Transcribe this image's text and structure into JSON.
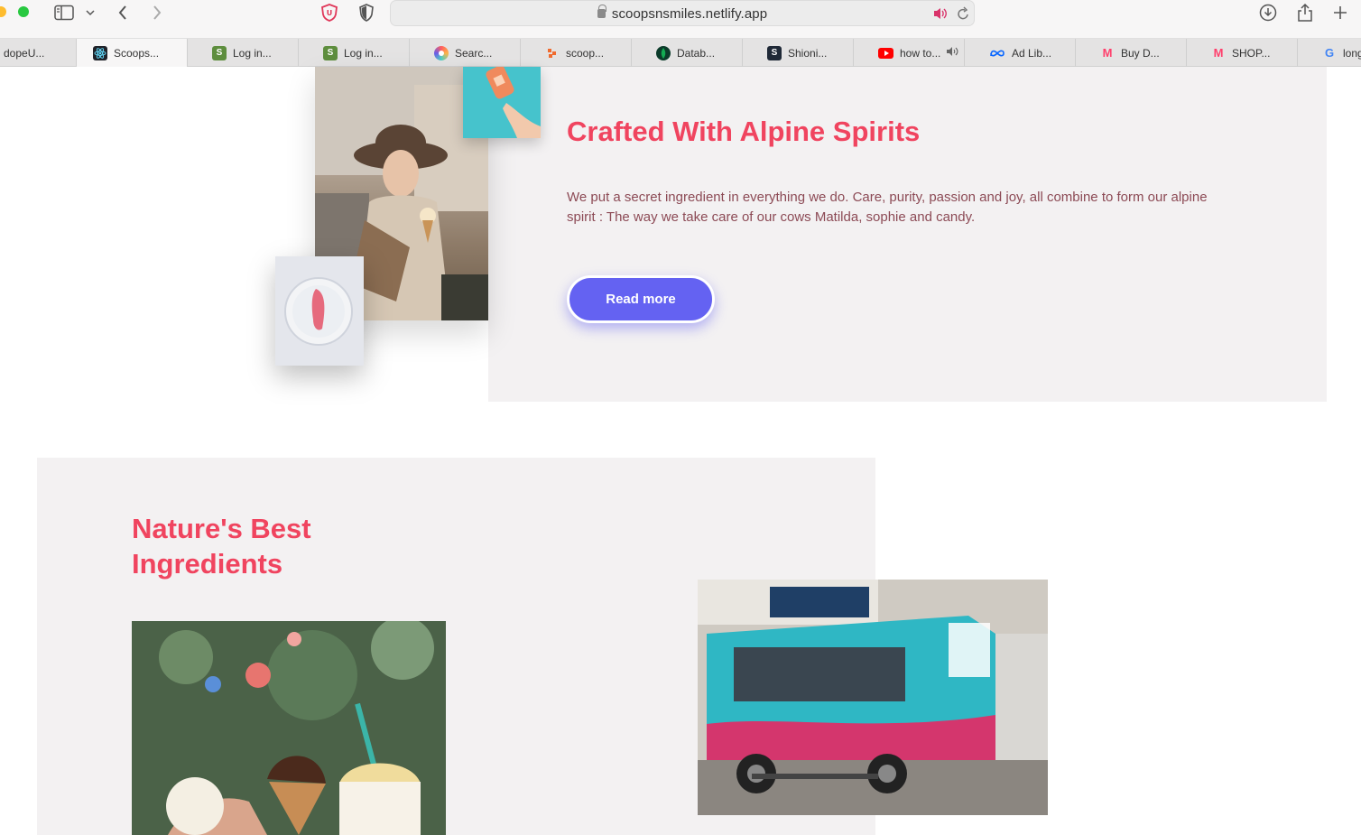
{
  "browser": {
    "url": "scoopsnsmiles.netlify.app",
    "tabs": [
      {
        "label": "dopeU...",
        "icon": "blank-icon",
        "color": "#e4e3e3"
      },
      {
        "label": "Scoops...",
        "icon": "react-icon",
        "color": "#20232a"
      },
      {
        "label": "Log in...",
        "icon": "shopify-icon",
        "color": "#5e8e3e"
      },
      {
        "label": "Log in...",
        "icon": "shopify-icon",
        "color": "#5e8e3e"
      },
      {
        "label": "Searc...",
        "icon": "colorwheel-icon",
        "color": "#7b3fe4"
      },
      {
        "label": "scoop...",
        "icon": "netlify-icon",
        "color": "#f06b2f"
      },
      {
        "label": "Datab...",
        "icon": "mongodb-icon",
        "color": "#116149"
      },
      {
        "label": "Shioni...",
        "icon": "s-icon",
        "color": "#1f2937"
      },
      {
        "label": "how to...",
        "icon": "youtube-icon",
        "color": "#ff0000"
      },
      {
        "label": "Ad Lib...",
        "icon": "meta-icon",
        "color": "#0866ff"
      },
      {
        "label": "Buy D...",
        "icon": "myntra-icon",
        "color": "#ff3f6c"
      },
      {
        "label": "SHOP...",
        "icon": "myntra-icon",
        "color": "#ff3f6c"
      },
      {
        "label": "long",
        "icon": "google-icon",
        "color": "#4285f4"
      }
    ]
  },
  "section_alpine": {
    "title": "Crafted With Alpine Spirits",
    "body": "We put a secret ingredient in everything we do. Care, purity, passion and joy, all combine to form our alpine spirit : The way we take care of our cows Matilda, sophie and candy.",
    "button_label": "Read more"
  },
  "section_nature": {
    "title": "Nature's Best Ingredients"
  },
  "colors": {
    "heading": "#f0445f",
    "body_text": "#8c4a55",
    "button": "#6462f2",
    "panel": "#f3f1f2"
  }
}
